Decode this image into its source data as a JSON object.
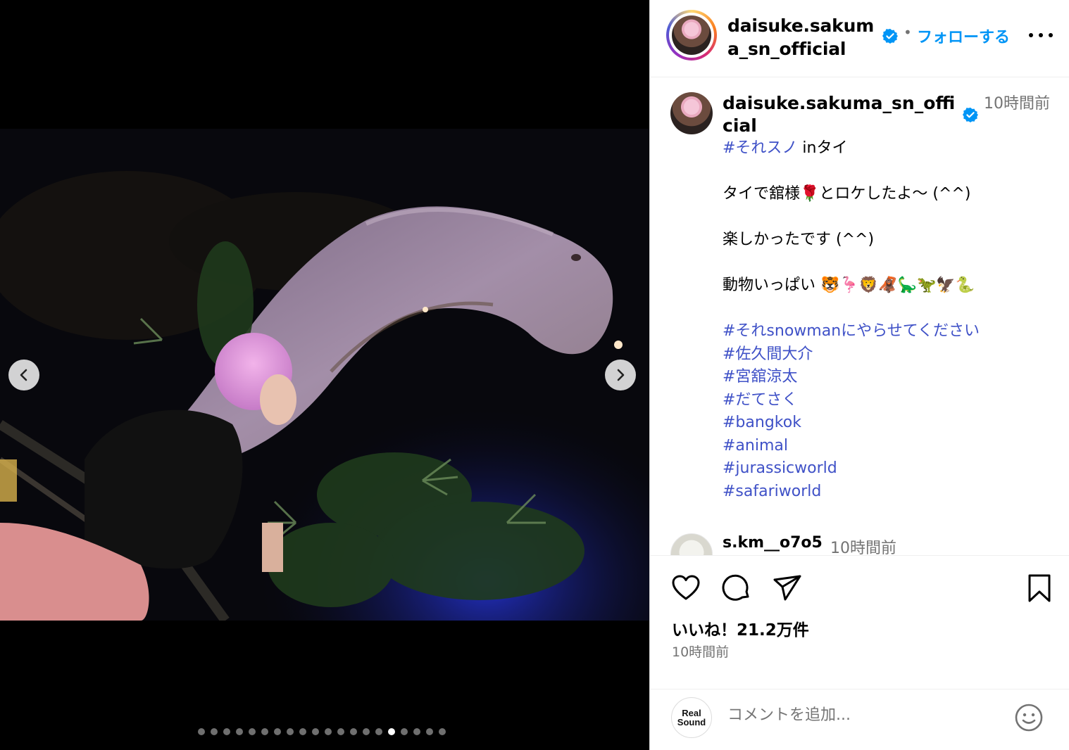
{
  "media": {
    "prev_label": "前へ",
    "next_label": "次へ",
    "dots_total": 20,
    "dots_active_index": 15
  },
  "header": {
    "username": "daisuke.sakuma_sn_official",
    "separator": "•",
    "follow_label": "フォローする"
  },
  "caption": {
    "username": "daisuke.sakuma_sn_official",
    "time": "10時間前",
    "lines": [
      {
        "tag": "#それスノ",
        "text": " inタイ"
      },
      {
        "tag": "",
        "text": ""
      },
      {
        "tag": "",
        "text": "タイで舘様🌹とロケしたよ〜 (^^)"
      },
      {
        "tag": "",
        "text": ""
      },
      {
        "tag": "",
        "text": "楽しかったです (^^)"
      },
      {
        "tag": "",
        "text": ""
      },
      {
        "tag": "",
        "text": "動物いっぱい 🐯🦩🦁🦧🦕🦖🦅🐍"
      },
      {
        "tag": "",
        "text": ""
      },
      {
        "tag": "#それsnowmanにやらせてください",
        "text": ""
      },
      {
        "tag": "#佐久間大介",
        "text": ""
      },
      {
        "tag": "#宮舘涼太",
        "text": ""
      },
      {
        "tag": "#だてさく",
        "text": ""
      },
      {
        "tag": "#bangkok",
        "text": ""
      },
      {
        "tag": "#animal",
        "text": ""
      },
      {
        "tag": "#jurassicworld",
        "text": ""
      },
      {
        "tag": "#safariworld",
        "text": ""
      }
    ]
  },
  "comment": {
    "username": "s.km__o7o5",
    "time": "10時間前"
  },
  "actions": {
    "likes": "いいね！21.2万件",
    "posted": "10時間前"
  },
  "add_comment": {
    "logo_line1": "Real",
    "logo_line2": "Sound",
    "placeholder": "コメントを追加..."
  },
  "colors": {
    "link": "#3f51c7",
    "follow": "#0095f6",
    "verified": "#0095f6",
    "muted": "#737373"
  }
}
